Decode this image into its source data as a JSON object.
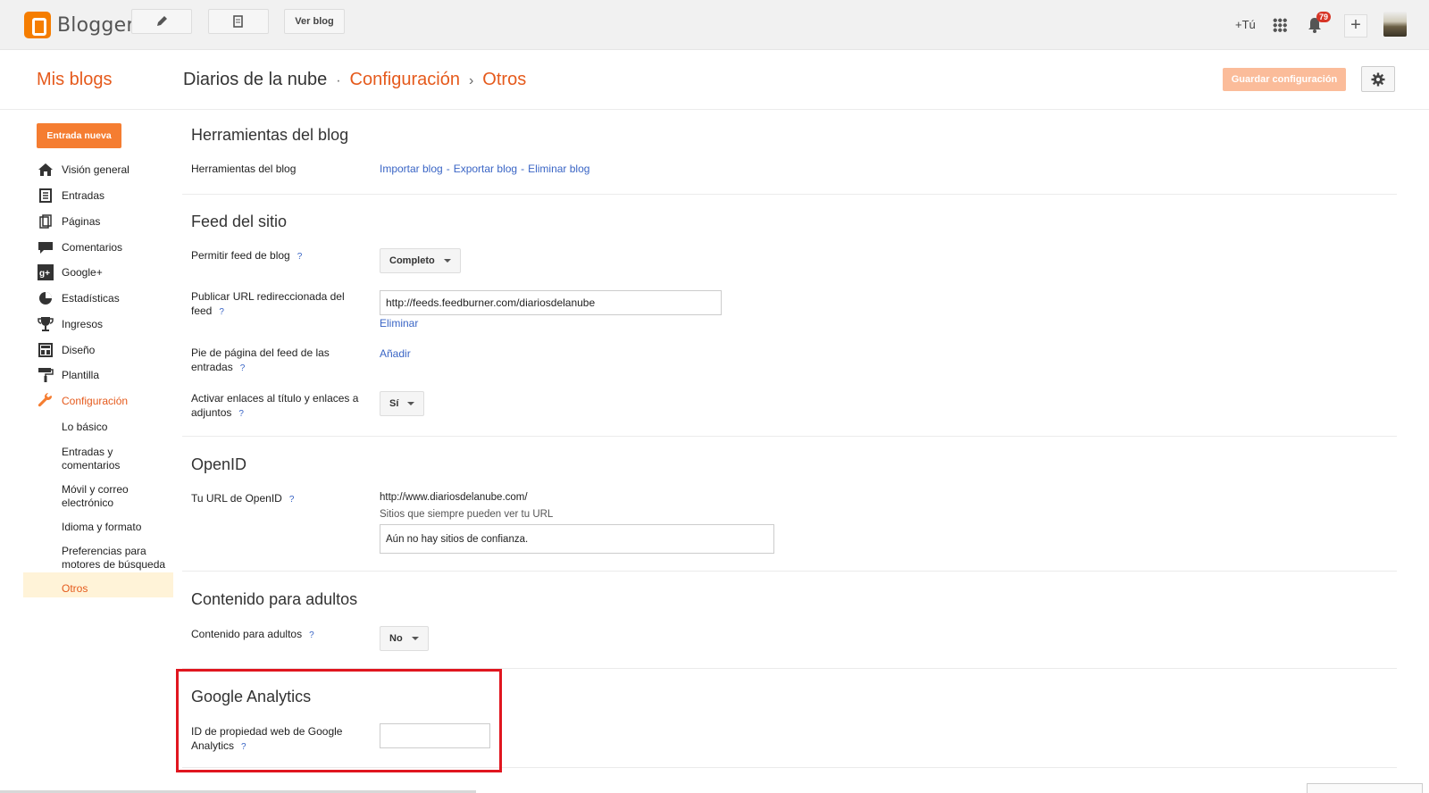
{
  "topbar": {
    "logo_text": "Blogger",
    "ver_blog": "Ver blog",
    "plus_tu": "+Tú",
    "notifications": "79"
  },
  "header": {
    "mis_blogs": "Mis blogs",
    "blog_name": "Diarios de la nube",
    "sep1": "·",
    "section": "Configuración",
    "sep2": "›",
    "page": "Otros",
    "save_label": "Guardar configuración"
  },
  "sidebar": {
    "new_post": "Entrada nueva",
    "items": [
      {
        "label": "Visión general",
        "icon": "home-icon"
      },
      {
        "label": "Entradas",
        "icon": "posts-icon"
      },
      {
        "label": "Páginas",
        "icon": "pages-icon"
      },
      {
        "label": "Comentarios",
        "icon": "comments-icon"
      },
      {
        "label": "Google+",
        "icon": "googleplus-icon"
      },
      {
        "label": "Estadísticas",
        "icon": "stats-icon"
      },
      {
        "label": "Ingresos",
        "icon": "trophy-icon"
      },
      {
        "label": "Diseño",
        "icon": "layout-icon"
      },
      {
        "label": "Plantilla",
        "icon": "paint-roller-icon"
      },
      {
        "label": "Configuración",
        "icon": "wrench-icon"
      }
    ],
    "subitems": [
      "Lo básico",
      "Entradas y comentarios",
      "Móvil y correo electrónico",
      "Idioma y formato",
      "Preferencias para motores de búsqueda",
      "Otros"
    ]
  },
  "main": {
    "tools": {
      "title": "Herramientas del blog",
      "label": "Herramientas del blog",
      "import": "Importar blog",
      "export": "Exportar blog",
      "delete": "Eliminar blog",
      "dash": "-"
    },
    "feed": {
      "title": "Feed del sitio",
      "allow_label": "Permitir feed de blog",
      "allow_value": "Completo",
      "redirect_label": "Publicar URL redireccionada del feed",
      "redirect_value": "http://feeds.feedburner.com/diariosdelanube",
      "redirect_remove": "Eliminar",
      "footer_label": "Pie de página del feed de las entradas",
      "footer_add": "Añadir",
      "links_label": "Activar enlaces al título y enlaces a adjuntos",
      "links_value": "Sí"
    },
    "openid": {
      "title": "OpenID",
      "label": "Tu URL de OpenID",
      "url": "http://www.diariosdelanube.com/",
      "note": "Sitios que siempre pueden ver tu URL",
      "box": "Aún no hay sitios de confianza."
    },
    "adult": {
      "title": "Contenido para adultos",
      "label": "Contenido para adultos",
      "value": "No"
    },
    "analytics": {
      "title": "Google Analytics",
      "label": "ID de propiedad web de Google Analytics",
      "value": ""
    },
    "help_mark": "?"
  },
  "colors": {
    "accent": "#e55a1c",
    "link": "#3a65c5",
    "highlight_box": "#e0161f"
  }
}
